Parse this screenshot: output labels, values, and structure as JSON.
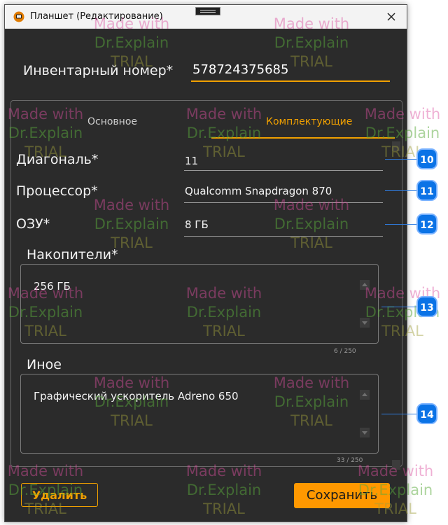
{
  "window": {
    "title": "Планшет (Редактирование)"
  },
  "inventory": {
    "label": "Инвентарный номер*",
    "value": "578724375685"
  },
  "tabs": [
    {
      "label": "Основное",
      "active": false
    },
    {
      "label": "Комплектующие",
      "active": true
    }
  ],
  "fields": {
    "diagonal": {
      "label": "Диагональ*",
      "value": "11"
    },
    "processor": {
      "label": "Процессор*",
      "value": "Qualcomm Snapdragon 870"
    },
    "ram": {
      "label": "ОЗУ*",
      "value": "8 ГБ"
    }
  },
  "storage": {
    "label": "Накопители*",
    "value": "256 ГБ",
    "counter": "6 / 250"
  },
  "other": {
    "label": "Иное",
    "value": "Графический ускоритель Adreno 650",
    "counter": "33 / 250"
  },
  "buttons": {
    "delete": "Удалить",
    "save": "Сохранить"
  },
  "callouts": [
    "10",
    "11",
    "12",
    "13",
    "14"
  ],
  "watermark": {
    "line1": "Made with",
    "line2": "Dr.Explain",
    "line3": "TRIAL"
  },
  "colors": {
    "accent": "#f0a000",
    "callout": "#0b73e6",
    "window_bg": "#2b2b2b"
  }
}
